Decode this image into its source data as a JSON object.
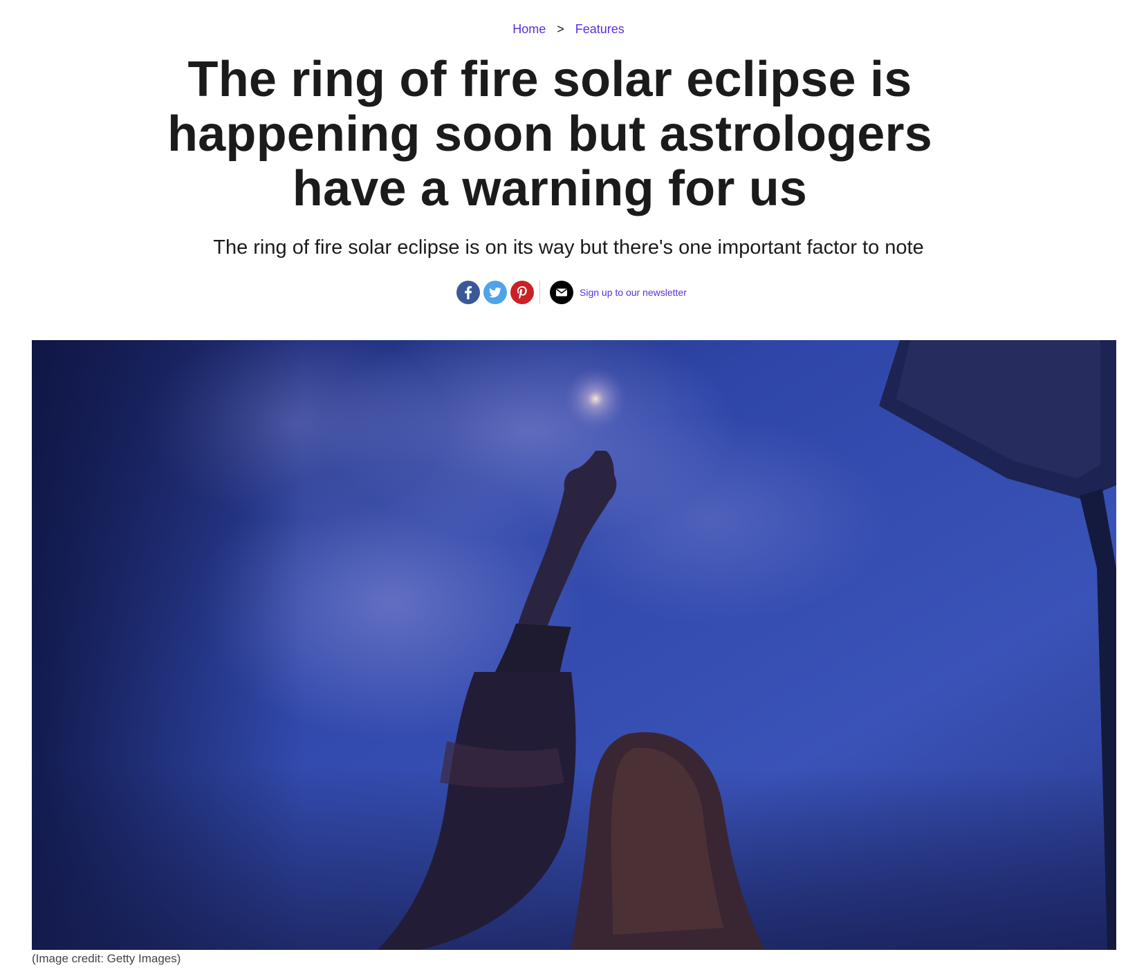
{
  "breadcrumb": {
    "home": "Home",
    "separator": ">",
    "section": "Features"
  },
  "article": {
    "title": "The ring of fire solar eclipse is happening soon but astrologers have a warning for us",
    "subtitle": "The ring of fire solar eclipse is on its way but there's one important factor to note"
  },
  "share": {
    "facebook_icon": "facebook-icon",
    "twitter_icon": "twitter-icon",
    "pinterest_icon": "pinterest-icon",
    "newsletter_icon": "envelope-icon",
    "newsletter_label": "Sign up to our newsletter"
  },
  "hero_image": {
    "credit": "(Image credit: Getty Images)"
  },
  "colors": {
    "link": "#5a2ee0",
    "facebook": "#3b5998",
    "twitter": "#4fa3ea",
    "pinterest": "#cb2027",
    "sky": "#2b3f9a"
  }
}
